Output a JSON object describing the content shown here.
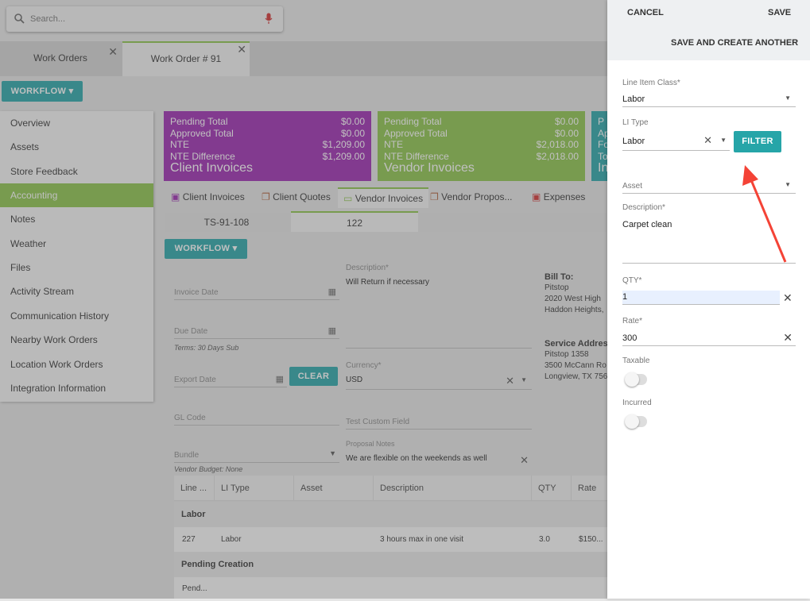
{
  "search": {
    "placeholder": "Search..."
  },
  "tabs": [
    {
      "label": "Work Orders"
    },
    {
      "label": "Work Order # 91"
    }
  ],
  "workflow_label": "WORKFLOW",
  "sidebar": {
    "items": [
      {
        "label": "Overview"
      },
      {
        "label": "Assets"
      },
      {
        "label": "Store Feedback"
      },
      {
        "label": "Accounting"
      },
      {
        "label": "Notes"
      },
      {
        "label": "Weather"
      },
      {
        "label": "Files"
      },
      {
        "label": "Activity Stream"
      },
      {
        "label": "Communication History"
      },
      {
        "label": "Nearby Work Orders"
      },
      {
        "label": "Location Work Orders"
      },
      {
        "label": "Integration Information"
      }
    ]
  },
  "cards": {
    "client": {
      "pending_label": "Pending Total",
      "pending": "$0.00",
      "approved_label": "Approved Total",
      "approved": "$0.00",
      "nte_label": "NTE",
      "nte": "$1,209.00",
      "diff_label": "NTE Difference",
      "diff": "$1,209.00",
      "title": "Client Invoices"
    },
    "vendor": {
      "pending_label": "Pending Total",
      "pending": "$0.00",
      "approved_label": "Approved Total",
      "approved": "$0.00",
      "nte_label": "NTE",
      "nte": "$2,018.00",
      "diff_label": "NTE Difference",
      "diff": "$2,018.00",
      "title": "Vendor Invoices"
    },
    "third": {
      "l1": "P",
      "l2": "Ap",
      "l3": "Fo",
      "l4": "To",
      "l5": "In"
    }
  },
  "subtabs": [
    "Client Invoices",
    "Client Quotes",
    "Vendor Invoices",
    "Vendor Propos...",
    "Expenses"
  ],
  "invoice_tabs": [
    "TS-91-108",
    "122"
  ],
  "form": {
    "description_label": "Description*",
    "description_value": "Will Return if necessary",
    "invoice_date_label": "Invoice Date",
    "due_date_label": "Due Date",
    "terms": "Terms: 30 Days Sub",
    "export_date_label": "Export Date",
    "clear_label": "CLEAR",
    "currency_label": "Currency*",
    "currency_value": "USD",
    "gl_code_label": "GL Code",
    "test_custom_label": "Test Custom Field",
    "bundle_label": "Bundle",
    "vendor_budget": "Vendor Budget: None",
    "proposal_notes_label": "Proposal Notes",
    "proposal_notes_value": "We are flexible on the weekends as well",
    "bill_to_label": "Bill To:",
    "bill_to_lines": [
      "Pitstop",
      "2020 West High",
      "Haddon Heights,"
    ],
    "service_address_label": "Service Address",
    "service_lines": [
      "Pitstop 1358",
      "3500 McCann Ro",
      "Longview, TX 756"
    ]
  },
  "table": {
    "headers": [
      "Line ...",
      "LI Type",
      "Asset",
      "Description",
      "QTY",
      "Rate"
    ],
    "group1": "Labor",
    "row1": {
      "line": "227",
      "type": "Labor",
      "asset": "",
      "desc": "3 hours max in one visit",
      "qty": "3.0",
      "rate": "$150..."
    },
    "group2": "Pending Creation",
    "row2": {
      "line": "Pend..."
    }
  },
  "panel": {
    "cancel": "CANCEL",
    "save": "SAVE",
    "save_another": "SAVE AND CREATE ANOTHER",
    "line_item_class_label": "Line Item Class*",
    "line_item_class": "Labor",
    "li_type_label": "LI Type",
    "li_type": "Labor",
    "filter": "FILTER",
    "asset_label": "Asset",
    "description_label": "Description*",
    "description": "Carpet clean",
    "qty_label": "QTY*",
    "qty": "1",
    "rate_label": "Rate*",
    "rate": "300",
    "taxable_label": "Taxable",
    "incurred_label": "Incurred"
  },
  "colors": {
    "teal": "#26a5a8",
    "green": "#8bc34a",
    "purple": "#9c27b0",
    "arrow": "#f44336"
  }
}
